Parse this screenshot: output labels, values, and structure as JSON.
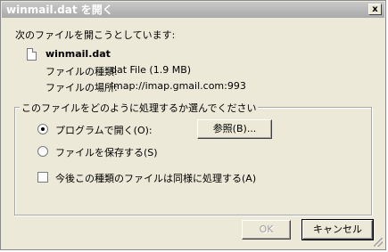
{
  "window": {
    "title": "winmail.dat を開く",
    "close_glyph": "x"
  },
  "dialog": {
    "intro": "次のファイルを開こうとしています:",
    "file_icon": "file-icon",
    "file_name": "winmail.dat",
    "type_label": "ファイルの種類:",
    "type_value": "dat File (1.9 MB)",
    "location_label": "ファイルの場所:",
    "location_value": "imap://imap.gmail.com:993"
  },
  "group": {
    "legend": "このファイルをどのように処理するか選んでください",
    "option_open": "プログラムで開く(O):",
    "option_save": "ファイルを保存する(S)",
    "selected": "open",
    "browse_label": "参照(B)...",
    "remember_label": "今後この種類のファイルは同様に処理する(A)",
    "remember_checked": false
  },
  "buttons": {
    "ok_label": "OK",
    "cancel_label": "キャンセル"
  }
}
